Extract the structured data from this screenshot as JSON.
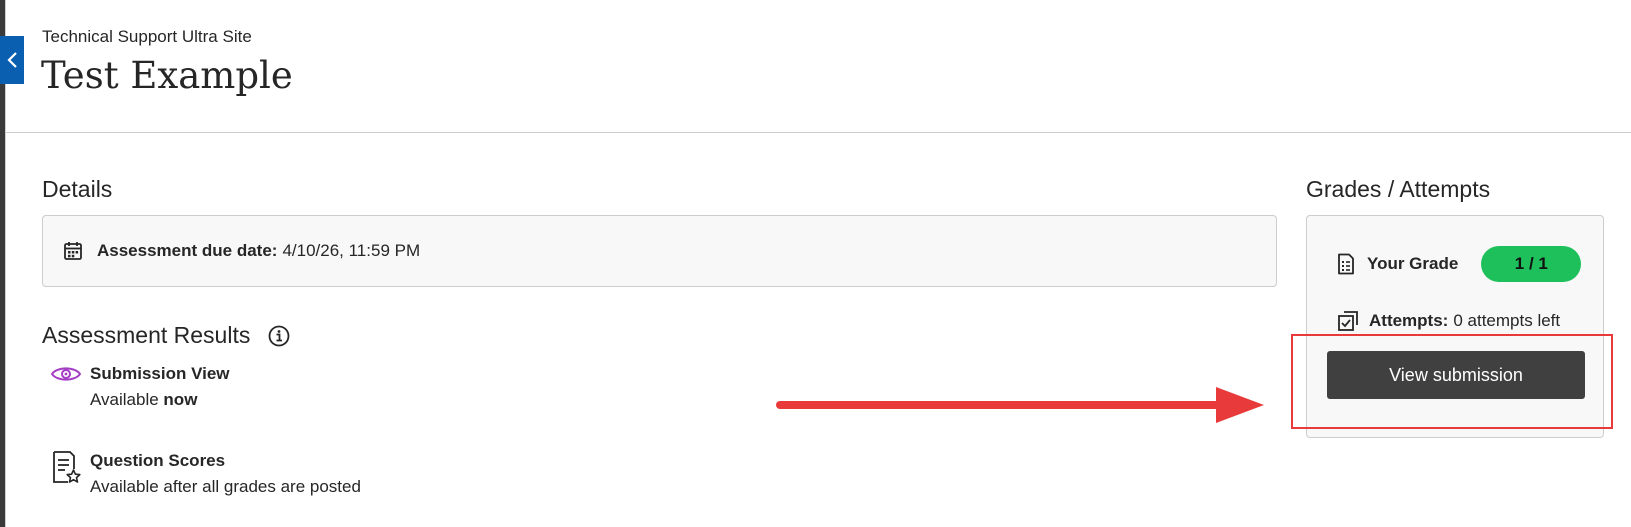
{
  "header": {
    "course_name": "Technical Support Ultra Site",
    "page_title": "Test Example"
  },
  "details": {
    "heading": "Details",
    "due_label": "Assessment due date:",
    "due_value": "4/10/26, 11:59 PM"
  },
  "results": {
    "heading": "Assessment Results",
    "items": [
      {
        "title": "Submission View",
        "status_prefix": "Available",
        "status_emphasis": "now",
        "icon": "eye-icon"
      },
      {
        "title": "Question Scores",
        "status": "Available after all grades are posted",
        "icon": "document-star-icon"
      }
    ]
  },
  "grades": {
    "heading": "Grades / Attempts",
    "grade_label": "Your Grade",
    "grade_value": "1 / 1",
    "attempts_label": "Attempts:",
    "attempts_value": "0 attempts left",
    "view_button_label": "View submission"
  },
  "colors": {
    "accent_blue": "#0b5fb0",
    "grade_green": "#1dc05a",
    "button_dark": "#404040",
    "annotation_red": "#e83a3a",
    "eye_purple": "#a43cc4"
  }
}
